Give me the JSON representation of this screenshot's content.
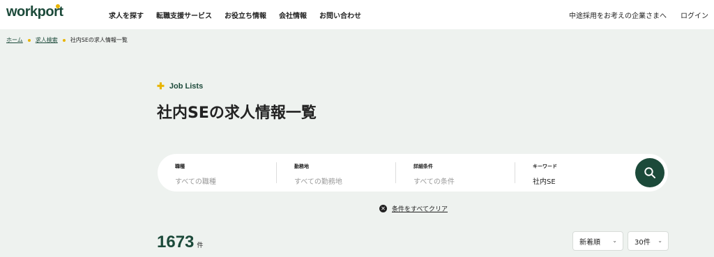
{
  "header": {
    "logo": "workport",
    "nav": [
      "求人を探す",
      "転職支援サービス",
      "お役立ち情報",
      "会社情報",
      "お問い合わせ"
    ],
    "right_links": [
      "中途採用をお考えの企業さまへ",
      "ログイン"
    ]
  },
  "breadcrumb": {
    "items": [
      "ホーム",
      "求人検索",
      "社内SEの求人情報一覧"
    ]
  },
  "title_area": {
    "eyebrow": "Job Lists",
    "title": "社内SEの求人情報一覧"
  },
  "search": {
    "fields": [
      {
        "label": "職種",
        "value": "すべての職種"
      },
      {
        "label": "勤務地",
        "value": "すべての勤務地"
      },
      {
        "label": "詳細条件",
        "value": "すべての条件"
      },
      {
        "label": "キーワード",
        "value": "社内SE"
      }
    ],
    "button_icon": "search-icon"
  },
  "clear": {
    "label": "条件をすべてクリア",
    "icon": "close-circle-icon"
  },
  "results": {
    "count": "1673",
    "unit": "件",
    "sort": {
      "selected": "新着順"
    },
    "per_page": {
      "selected": "30件"
    }
  },
  "colors": {
    "brand": "#1c4a3a",
    "accent": "#e8b400",
    "background": "#eef2ef"
  }
}
